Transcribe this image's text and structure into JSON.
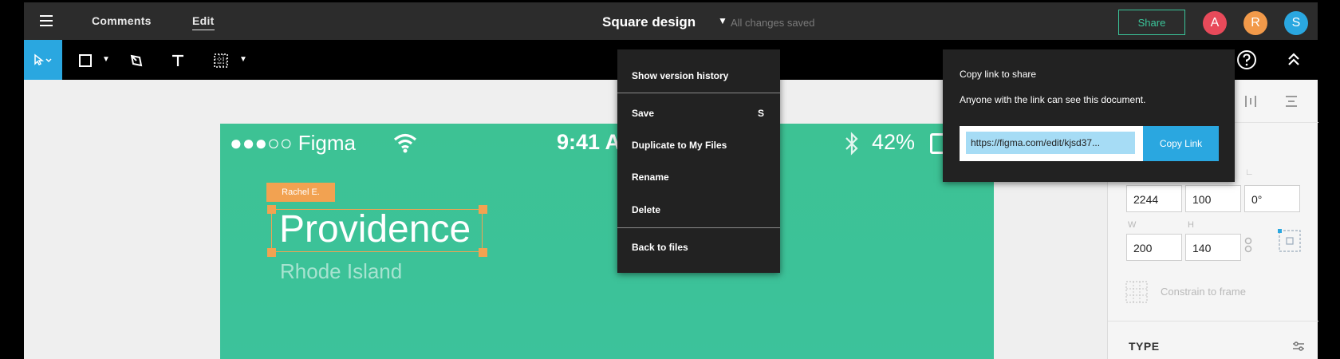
{
  "topbar": {
    "menu_comments": "Comments",
    "menu_edit": "Edit",
    "doc_title": "Square design",
    "save_status": "All changes saved",
    "share_label": "Share",
    "avatars": [
      {
        "initial": "A",
        "color": "#e84a5a"
      },
      {
        "initial": "R",
        "color": "#f29a4a"
      },
      {
        "initial": "S",
        "color": "#2aa7e0"
      }
    ]
  },
  "toolbar": {
    "tools": [
      "select-icon",
      "rectangle-icon",
      "pen-icon",
      "text-icon",
      "frame-grid-icon"
    ],
    "right_icons": [
      "help-icon",
      "collapse-icon"
    ]
  },
  "canvas": {
    "status_left": "●●●○○ Figma",
    "status_time": "9:41 A",
    "status_battery": "42%",
    "collaborator_tag": "Rachel E.",
    "city_title": "Providence",
    "state_subtitle": "Rhode Island"
  },
  "right_panel": {
    "x_value": "2244",
    "y_value": "100",
    "rotation_value": "0°",
    "w_label": "W",
    "h_label": "H",
    "w_value": "200",
    "h_value": "140",
    "constrain_label": "Constrain to frame",
    "type_heading": "TYPE"
  },
  "version_menu": {
    "items": [
      {
        "label": "Show version history"
      },
      {
        "label": "Save",
        "shortcut": "S"
      },
      {
        "label": "Duplicate to My Files"
      },
      {
        "label": "Rename"
      },
      {
        "label": "Delete"
      },
      {
        "label": "Back to files"
      }
    ]
  },
  "share_popover": {
    "heading": "Copy link to share",
    "description": "Anyone with the link can see this document.",
    "url": "https://figma.com/edit/kjsd37...",
    "copy_label": "Copy Link"
  },
  "colors": {
    "accent_blue": "#2aa7e0",
    "share_green": "#3bc59a",
    "artboard_green": "#3dc294",
    "selection_orange": "#f2a251"
  }
}
